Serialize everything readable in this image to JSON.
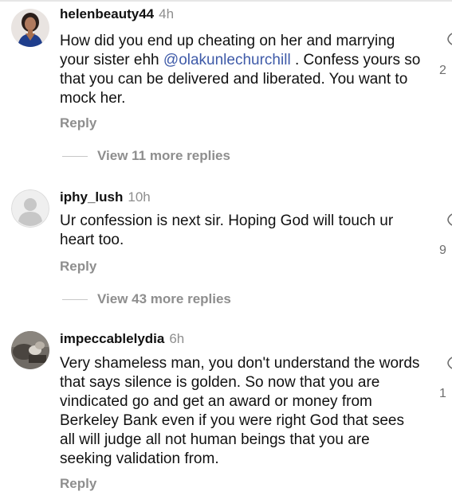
{
  "comments": [
    {
      "username": "helenbeauty44",
      "time": "4h",
      "text_before": "How did you end up cheating on her and marrying your sister ehh ",
      "mention": "@olakunlechurchill",
      "text_after": " . Confess yours so that you can be delivered and liberated. You want to mock her.",
      "reply_label": "Reply",
      "view_replies": "View 11 more replies",
      "like_count": "2"
    },
    {
      "username": "iphy_lush",
      "time": "10h",
      "text": "Ur confession is next sir. Hoping God will touch ur heart too.",
      "reply_label": "Reply",
      "view_replies": "View 43 more replies",
      "like_count": "9"
    },
    {
      "username": "impeccablelydia",
      "time": "6h",
      "text": "Very shameless man,  you don't understand the words that says silence is golden. So now that you are vindicated go and get an award or money from Berkeley Bank even if you were right God that sees all will judge all  not human beings that you are seeking  validation from.",
      "reply_label": "Reply",
      "like_count": "1"
    }
  ],
  "icons": {
    "like": "heart-icon",
    "avatar_default": "default-avatar-icon"
  },
  "colors": {
    "mention": "#3e5aa8",
    "meta_gray": "#8e8e8e"
  }
}
